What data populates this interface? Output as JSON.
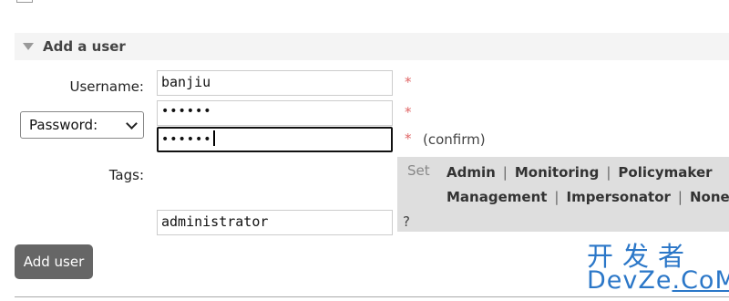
{
  "section": {
    "title": "Add a user"
  },
  "form": {
    "username_label": "Username:",
    "username_value": "banjiu",
    "password_select": "Password:",
    "password_value": "••••••",
    "confirm_value": "••••••",
    "required_mark": "*",
    "confirm_text": "(confirm)",
    "tags_label": "Tags:",
    "tags_value": "administrator",
    "tags_help": "?"
  },
  "tags_panel": {
    "set_label": "Set",
    "row1": [
      "Admin",
      "Monitoring",
      "Policymaker"
    ],
    "row2": [
      "Management",
      "Impersonator",
      "None"
    ],
    "separator": "|"
  },
  "add_button": "Add user",
  "watermark": {
    "cn": "开发者",
    "en_part1": "DevZe",
    "en_part2": ".CoM"
  },
  "colors": {
    "required": "#e06666",
    "button_bg": "#666666",
    "tags_panel_bg": "#dedede",
    "watermark": "#2b77c8"
  }
}
